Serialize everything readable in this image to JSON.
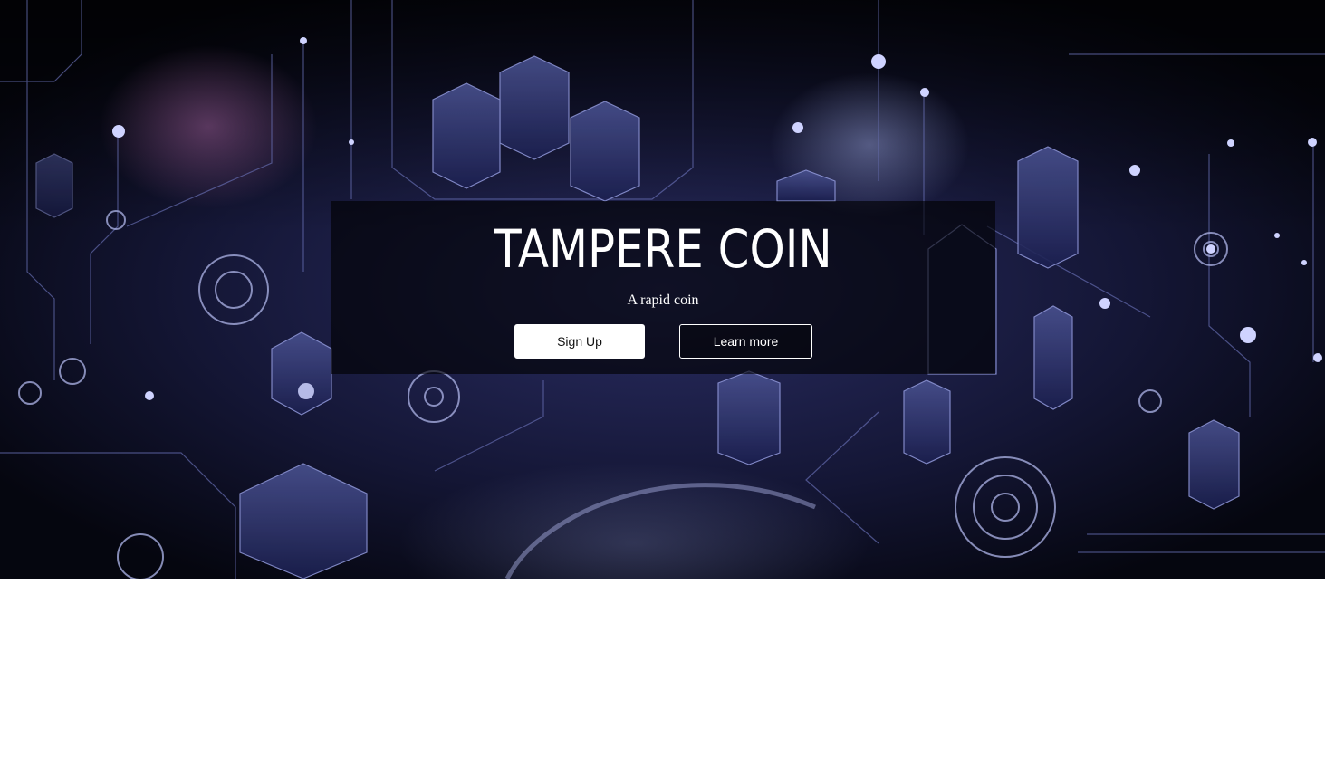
{
  "hero": {
    "title": "TAMPERE COIN",
    "subtitle": "A rapid coin",
    "buttons": {
      "signup_label": "Sign Up",
      "learn_more_label": "Learn more"
    }
  },
  "colors": {
    "background_dark": "#0a0c22",
    "accent_blue": "#3a3f7a",
    "panel_overlay": "#000000",
    "text": "#ffffff",
    "page_background": "#ffffff"
  }
}
